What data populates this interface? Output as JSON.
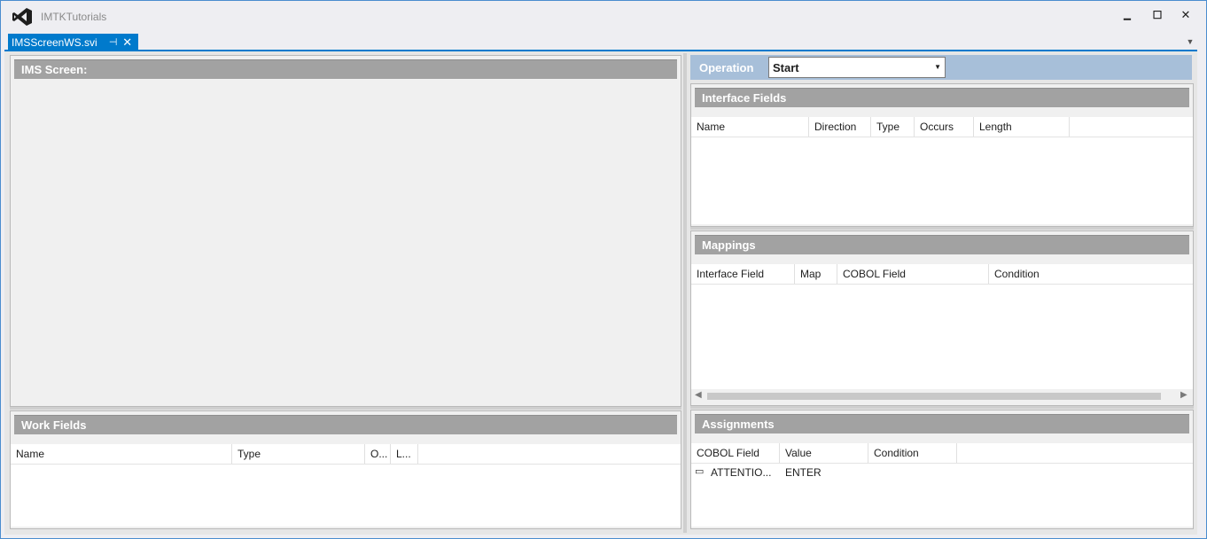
{
  "app": {
    "title": "IMTKTutorials"
  },
  "window_controls": {
    "minimize": "▁",
    "maximize": "☐",
    "close": "✕"
  },
  "tab": {
    "label": "IMSScreenWS.svi",
    "pin_icon": "⊣",
    "close_icon": "✕"
  },
  "left_panel": {
    "ims_screen": {
      "title": "IMS Screen:"
    },
    "work_fields": {
      "title": "Work Fields",
      "columns": [
        "Name",
        "Type",
        "O...",
        "L..."
      ]
    }
  },
  "operation": {
    "label": "Operation",
    "selected": "Start"
  },
  "interface_fields": {
    "title": "Interface Fields",
    "columns": [
      "Name",
      "Direction",
      "Type",
      "Occurs",
      "Length"
    ]
  },
  "mappings": {
    "title": "Mappings",
    "columns": [
      "Interface Field",
      "Map",
      "COBOL Field",
      "Condition"
    ]
  },
  "assignments": {
    "title": "Assignments",
    "columns": [
      "COBOL Field",
      "Value",
      "Condition"
    ],
    "rows": [
      {
        "expander": "▭",
        "cobol_field": "ATTENTIO...",
        "value": "ENTER",
        "condition": ""
      }
    ]
  },
  "colors": {
    "accent": "#007acc",
    "header_gray": "#a2a2a2",
    "operation_bar": "#a7bfd9"
  },
  "icons": {
    "logo": "visual-studio-logo-icon",
    "dropdown": "chevron-down-icon"
  }
}
